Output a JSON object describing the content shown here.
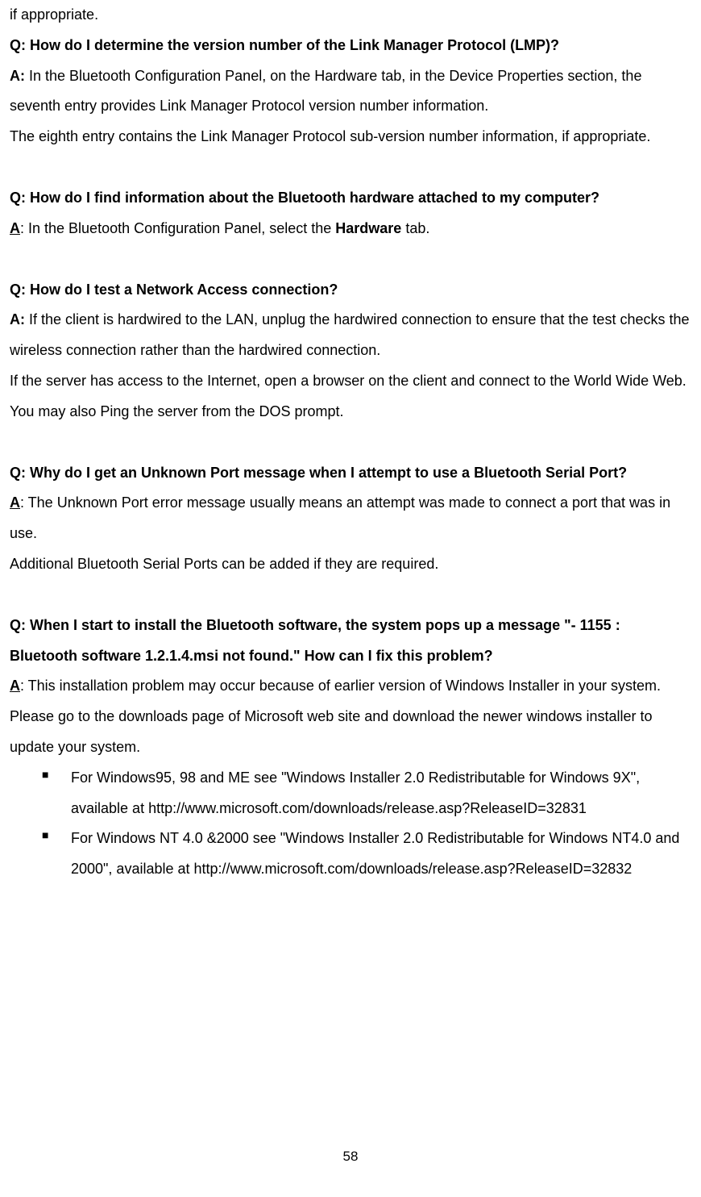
{
  "p0": "if appropriate.",
  "q1": "Q: How do I determine the version number of the Link Manager Protocol (LMP)?",
  "a1_label": "A:",
  "a1_text": " In the Bluetooth Configuration Panel, on the Hardware tab, in the Device Properties section, the seventh entry provides Link Manager Protocol version number information.",
  "a1_p2": "The eighth entry contains the Link Manager Protocol sub-version number information, if appropriate.",
  "q2": "Q: How do I find information about the Bluetooth hardware attached to my computer?",
  "a2_label": "A",
  "a2_text": ": In the Bluetooth Configuration Panel, select the ",
  "a2_bold": "Hardware",
  "a2_text2": " tab.",
  "q3": "Q: How do I test a Network Access connection?",
  "a3_label": "A:",
  "a3_text": " If the client is hardwired to the LAN, unplug the hardwired connection to ensure that the test checks the wireless connection rather than the hardwired connection.",
  "a3_p2": "If the server has access to the Internet, open a browser on the client and connect to the World Wide Web.",
  "a3_p3": "You may also Ping the server from the DOS prompt.",
  "q4": "Q: Why do I get an Unknown Port message when I attempt to use a Bluetooth Serial Port?",
  "a4_label": "A",
  "a4_text": ": The Unknown Port error message usually means an attempt was made to connect a port that was in use.",
  "a4_p2": "Additional Bluetooth Serial Ports can be added if they are required.",
  "q5": "Q: When I start to install the Bluetooth software, the system pops up a message \"- 1155 : Bluetooth software 1.2.1.4.msi not found.\" How can I fix this problem?",
  "a5_label": "A",
  "a5_text": ": This installation problem may occur because of earlier version of Windows Installer in your system. Please go to the downloads page of Microsoft web site and download the newer windows installer to update your system.",
  "bullet1": "For Windows95, 98 and ME see \"Windows Installer 2.0 Redistributable for Windows 9X\", available at http://www.microsoft.com/downloads/release.asp?ReleaseID=32831",
  "bullet2": "For Windows NT 4.0 &2000 see \"Windows Installer 2.0 Redistributable for Windows NT4.0 and 2000\", available at http://www.microsoft.com/downloads/release.asp?ReleaseID=32832",
  "page_number": "58"
}
